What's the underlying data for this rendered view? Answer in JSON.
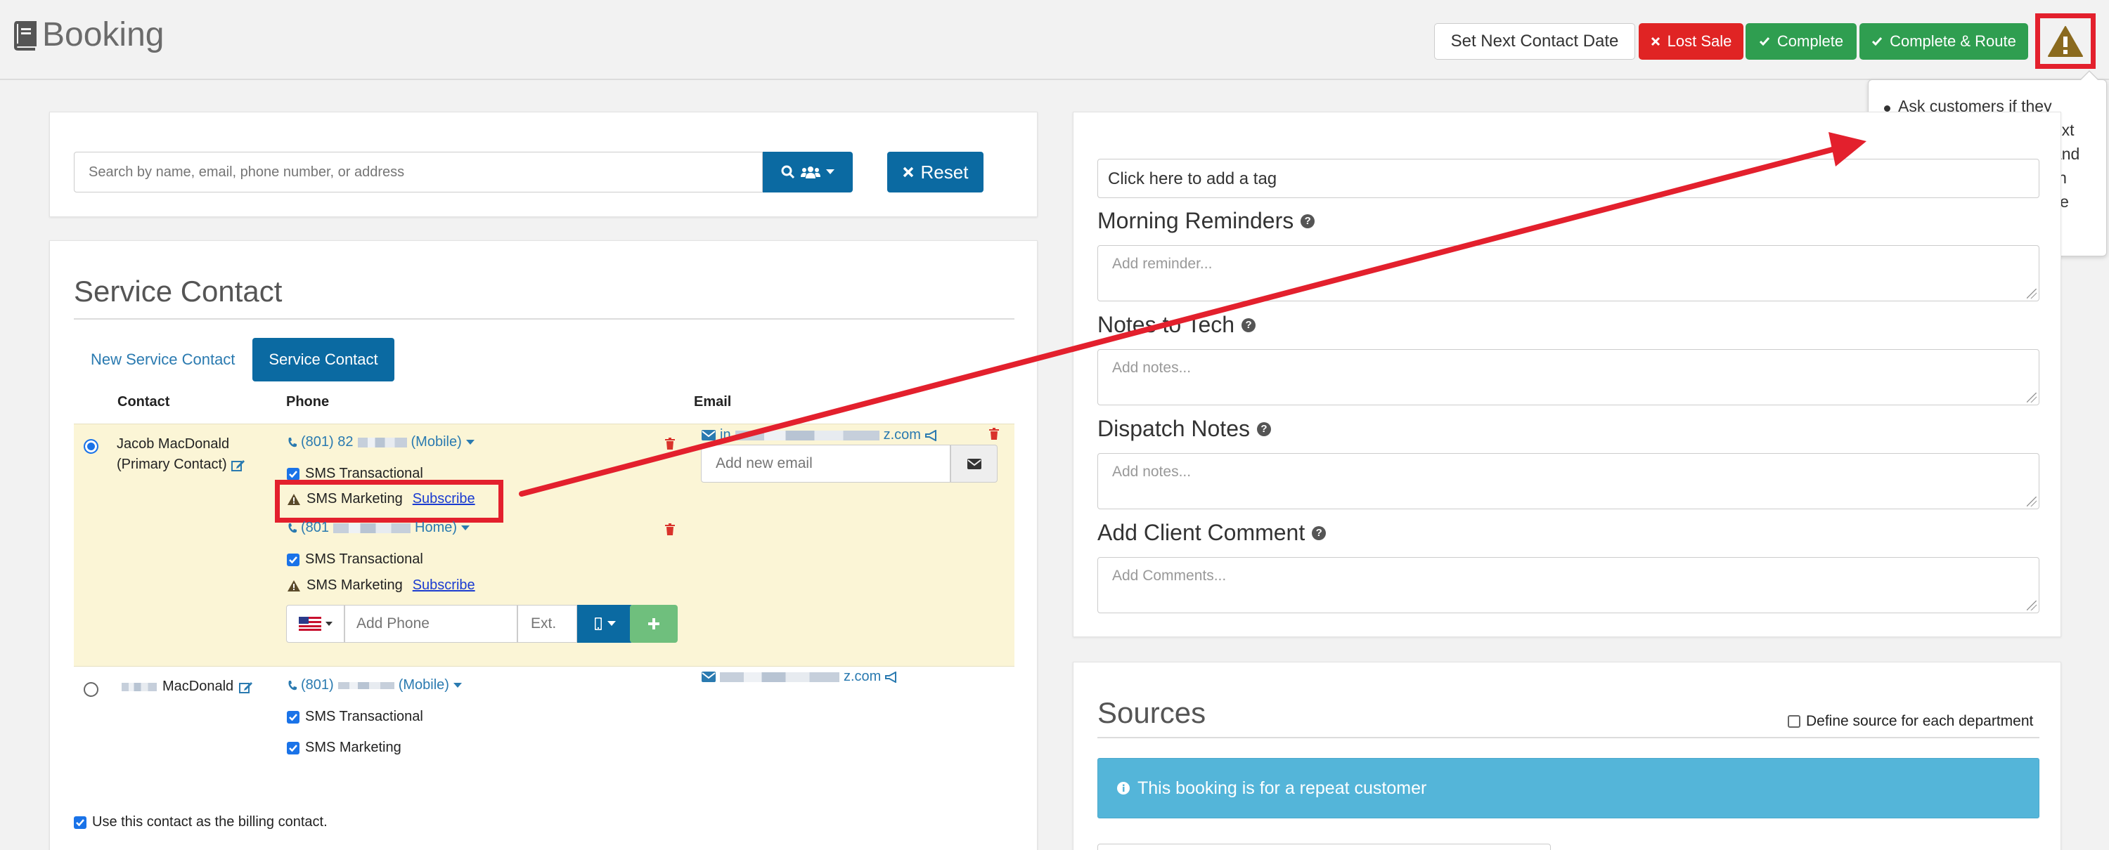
{
  "header": {
    "title": "Booking",
    "buttons": {
      "next_contact": "Set Next Contact Date",
      "lost_sale": "Lost Sale",
      "complete": "Complete",
      "complete_route": "Complete & Route"
    },
    "tooltip": "Ask customers if they would like to receive text promotions, coupons and special deals. They can unsubscribe at any time"
  },
  "search": {
    "placeholder": "Search by name, email, phone number, or address",
    "reset_label": "Reset"
  },
  "service_contact": {
    "title": "Service Contact",
    "tabs": [
      "New Service Contact",
      "Service Contact"
    ],
    "columns": [
      "Contact",
      "Phone",
      "Email"
    ],
    "contacts": [
      {
        "name_line1": "Jacob MacDonald",
        "name_line2": "(Primary Contact)",
        "phones": [
          {
            "number": "(801) 82",
            "type": "(Mobile)",
            "sms_transactional": "SMS Transactional",
            "sms_marketing": "SMS Marketing",
            "subscribe": "Subscribe"
          },
          {
            "number": "(801",
            "type": "Home)",
            "sms_transactional": "SMS Transactional",
            "sms_marketing": "SMS Marketing",
            "subscribe": "Subscribe"
          }
        ],
        "email_start": "in",
        "email_end": "z.com",
        "email_placeholder": "Add new email",
        "phone_placeholder": "Add Phone",
        "ext_placeholder": "Ext."
      },
      {
        "name": "MacDonald",
        "phone_number": "(801)",
        "phone_type": "(Mobile)",
        "sms_transactional": "SMS Transactional",
        "sms_marketing": "SMS Marketing",
        "email_end": "z.com"
      }
    ],
    "billing_label": "Use this contact as the billing contact."
  },
  "details": {
    "tag_placeholder": "Click here to add a tag",
    "morning_reminders": "Morning Reminders",
    "reminder_placeholder": "Add reminder...",
    "notes_to_tech": "Notes to Tech",
    "notes_placeholder": "Add notes...",
    "dispatch_notes": "Dispatch Notes",
    "dispatch_placeholder": "Add notes...",
    "client_comment": "Add Client Comment",
    "comment_placeholder": "Add Comments..."
  },
  "sources": {
    "title": "Sources",
    "define_label": "Define source for each department",
    "info": "This booking is for a repeat customer"
  },
  "colors": {
    "primary": "#0b6aa2",
    "danger": "#e02424",
    "success": "#2f9e50",
    "annotation": "#e3202d",
    "info": "#54b5d9"
  }
}
